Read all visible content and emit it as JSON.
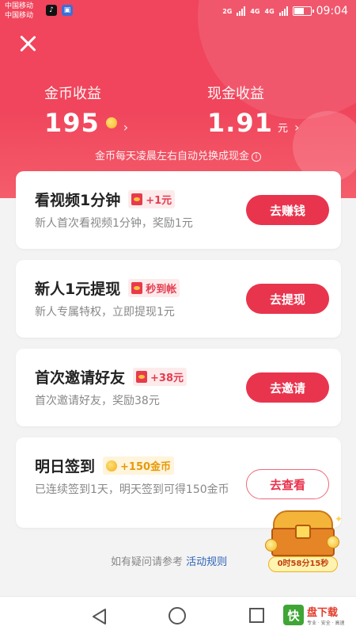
{
  "status_bar": {
    "carrier1": "中国移动",
    "carrier2": "中国移动",
    "net1": "2G",
    "net2": "4G",
    "net3": "4G",
    "time": "09:04"
  },
  "header": {
    "coin_label": "金币收益",
    "coin_value": "195",
    "cash_label": "现金收益",
    "cash_value": "1.91",
    "cash_unit": "元",
    "note": "金币每天凌晨左右自动兑换成现金",
    "bg_color": "#f0455c"
  },
  "tasks": [
    {
      "title": "看视频1分钟",
      "tag": "+1元",
      "desc": "新人首次看视频1分钟，奖励1元",
      "button": "去赚钱"
    },
    {
      "title": "新人1元提现",
      "tag": "秒到帐",
      "desc": "新人专属特权，立即提现1元",
      "button": "去提现"
    },
    {
      "title": "首次邀请好友",
      "tag": "+38元",
      "desc": "首次邀请好友，奖励38元",
      "button": "去邀请"
    },
    {
      "title": "明日签到",
      "tag": "+150金币",
      "desc": "已连续签到1天，明天签到可得150金币",
      "button": "去查看"
    }
  ],
  "footer": {
    "question": "如有疑问请参考",
    "rules_link": "活动规则"
  },
  "chest": {
    "timer": "0时58分15秒"
  },
  "watermark": {
    "logo": "快",
    "title": "盘下载",
    "sub": "专业 · 安全 · 高速"
  },
  "colors": {
    "accent": "#e9344e",
    "link": "#2e63b8"
  }
}
